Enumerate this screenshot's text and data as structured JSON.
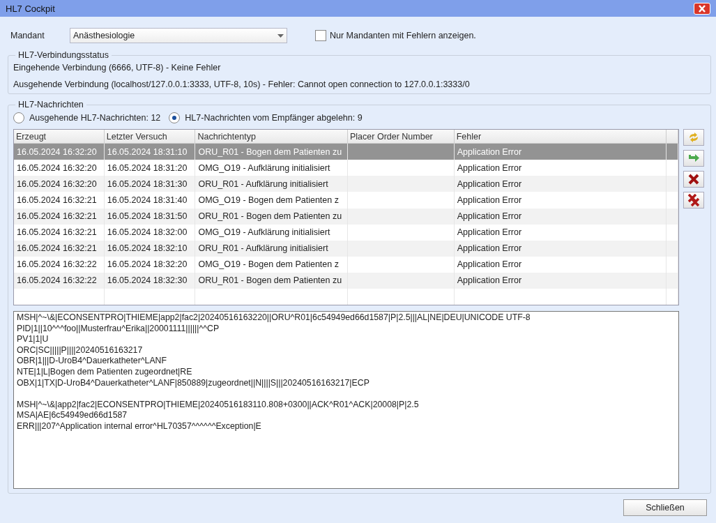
{
  "window": {
    "title": "HL7 Cockpit"
  },
  "mandant": {
    "label": "Mandant",
    "value": "Anästhesiologie"
  },
  "only_errors": {
    "label": "Nur Mandanten mit Fehlern anzeigen.",
    "checked": false
  },
  "status": {
    "title": "HL7-Verbindungsstatus",
    "lines": [
      "Eingehende Verbindung (6666, UTF-8) - Keine Fehler",
      "Ausgehende Verbindung (localhost/127.0.0.1:3333, UTF-8, 10s) - Fehler: Cannot open connection to 127.0.0.1:3333/0"
    ]
  },
  "messages": {
    "title": "HL7-Nachrichten",
    "filters": [
      {
        "label": "Ausgehende HL7-Nachrichten: 12",
        "selected": false
      },
      {
        "label": "HL7-Nachrichten vom Empfänger abgelehn: 9",
        "selected": true
      }
    ],
    "table": {
      "columns": [
        "Erzeugt",
        "Letzter Versuch",
        "Nachrichtentyp",
        "Placer Order Number",
        "Fehler"
      ],
      "rows": [
        {
          "selected": true,
          "cells": [
            "16.05.2024 16:32:20",
            "16.05.2024 18:31:10",
            "ORU_R01 - Bogen dem Patienten zu",
            "",
            "Application Error"
          ]
        },
        {
          "selected": false,
          "cells": [
            "16.05.2024 16:32:20",
            "16.05.2024 18:31:20",
            "OMG_O19 - Aufklärung initialisiert",
            "",
            "Application Error"
          ]
        },
        {
          "selected": false,
          "cells": [
            "16.05.2024 16:32:20",
            "16.05.2024 18:31:30",
            "ORU_R01 - Aufklärung initialisiert",
            "",
            "Application Error"
          ]
        },
        {
          "selected": false,
          "cells": [
            "16.05.2024 16:32:21",
            "16.05.2024 18:31:40",
            "OMG_O19 - Bogen dem Patienten z",
            "",
            "Application Error"
          ]
        },
        {
          "selected": false,
          "cells": [
            "16.05.2024 16:32:21",
            "16.05.2024 18:31:50",
            "ORU_R01 - Bogen dem Patienten zu",
            "",
            "Application Error"
          ]
        },
        {
          "selected": false,
          "cells": [
            "16.05.2024 16:32:21",
            "16.05.2024 18:32:00",
            "OMG_O19 - Aufklärung initialisiert",
            "",
            "Application Error"
          ]
        },
        {
          "selected": false,
          "cells": [
            "16.05.2024 16:32:21",
            "16.05.2024 18:32:10",
            "ORU_R01 - Aufklärung initialisiert",
            "",
            "Application Error"
          ]
        },
        {
          "selected": false,
          "cells": [
            "16.05.2024 16:32:22",
            "16.05.2024 18:32:20",
            "OMG_O19 - Bogen dem Patienten z",
            "",
            "Application Error"
          ]
        },
        {
          "selected": false,
          "cells": [
            "16.05.2024 16:32:22",
            "16.05.2024 18:32:30",
            "ORU_R01 - Bogen dem Patienten zu",
            "",
            "Application Error"
          ]
        }
      ]
    },
    "detail": [
      [
        "MSH|^~\\&|ECONSENTPRO|THIEME|app2|fac2|20240516163220||ORU^R01|6c54949ed66d1587|P|2.5|||AL|NE|DEU|UNICODE UTF-8",
        "PID|1||10^^^foo||Musterfrau^Erika||20001111||||||^^CP",
        "PV1|1|U",
        "ORC|SC|||||P||||20240516163217",
        "OBR|1|||D-UroB4^Dauerkatheter^LANF",
        "NTE|1|L|Bogen dem Patienten zugeordnet|RE",
        "OBX|1|TX|D-UroB4^Dauerkatheter^LANF|850889|zugeordnet||N||||S|||20240516163217|ECP"
      ],
      [
        "MSH|^~\\&|app2|fac2|ECONSENTPRO|THIEME|20240516183110.808+0300||ACK^R01^ACK|20008|P|2.5",
        "MSA|AE|6c54949ed66d1587",
        "ERR|||207^Application internal error^HL70357^^^^^^Exception|E"
      ]
    ]
  },
  "close_button": "Schließen"
}
